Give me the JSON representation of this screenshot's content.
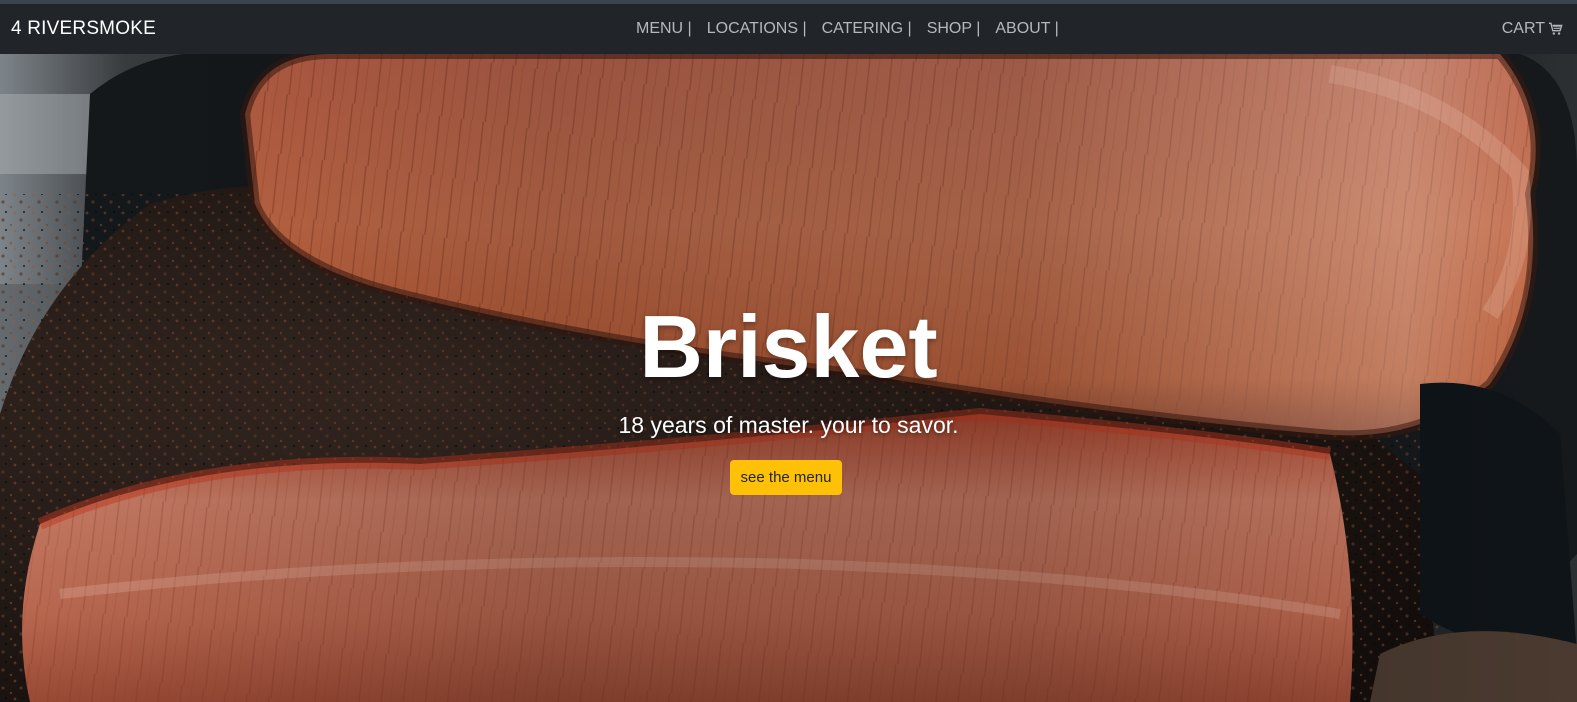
{
  "navbar": {
    "brand": "4 RIVERSMOKE",
    "links": [
      {
        "label": "MENU |"
      },
      {
        "label": "LOCATIONS |"
      },
      {
        "label": "CATERING |"
      },
      {
        "label": "SHOP |"
      },
      {
        "label": "ABOUT |"
      }
    ],
    "cart_label": "CART",
    "cart_icon": "shopping-cart-icon"
  },
  "hero": {
    "image": "brisket-photo",
    "title": "Brisket",
    "subtitle": "18 years of master. your to savor.",
    "button_label": "see the menu",
    "button_color": "#ffc107"
  },
  "colors": {
    "navbar_bg": "#212529",
    "nav_text": "#b5b8bc",
    "brand_text": "#ffffff"
  }
}
